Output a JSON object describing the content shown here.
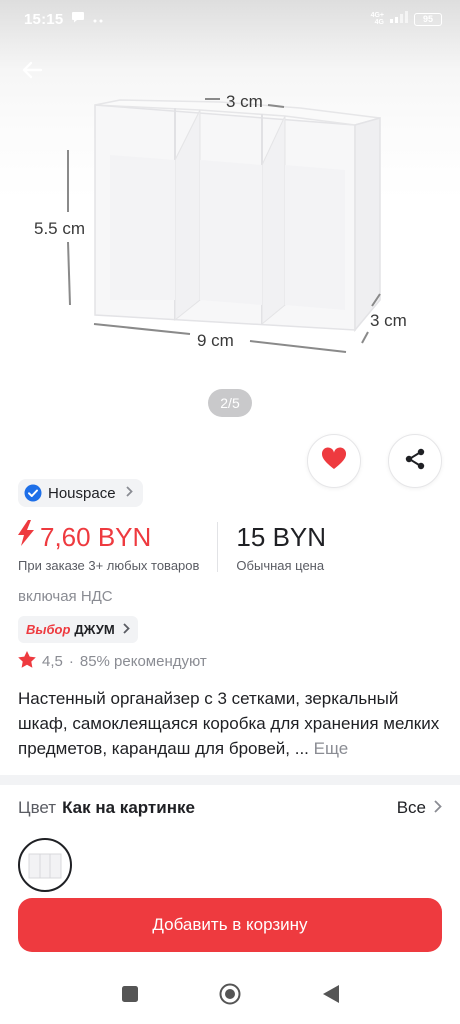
{
  "status_bar": {
    "time": "15:15",
    "network_top": "4G+",
    "network_bottom": "4G",
    "battery": "95"
  },
  "hero": {
    "dimension_top": "3 cm",
    "dimension_left": "5.5 cm",
    "dimension_right": "3 cm",
    "dimension_bottom": "9 cm",
    "pager": "2/5"
  },
  "seller": {
    "name": "Houspace"
  },
  "price": {
    "sale_price": "7,60 BYN",
    "sale_note": "При заказе 3+ любых товаров",
    "regular_price": "15 BYN",
    "regular_note": "Обычная цена"
  },
  "vat_text": "включая НДС",
  "choice_chip": {
    "brand": "Выбор",
    "name": "ДЖУМ"
  },
  "rating": {
    "value": "4,5",
    "separator": "·",
    "recommend": "85% рекомендуют",
    "stars": 1
  },
  "title": {
    "text": "Настенный органайзер с 3 сетками, зеркальный шкаф, самоклеящаяся коробка для хранения мелких предметов, карандаш для бровей, ...",
    "more": "Еще"
  },
  "color_selector": {
    "label": "Цвет",
    "value": "Как на картинке",
    "all": "Все"
  },
  "cart_button": {
    "label": "Добавить в корзину"
  },
  "colors": {
    "accent": "#ee3a3f",
    "badge_blue": "#1e6fe8",
    "text_primary": "#1f2024",
    "text_secondary": "#8a8c93"
  },
  "icons": {
    "back": "arrow-left-icon",
    "favorite": "heart-icon",
    "share": "share-icon",
    "verified": "check-badge-icon",
    "sale": "lightning-icon",
    "star": "star-icon",
    "chevron": "chevron-right-icon"
  }
}
